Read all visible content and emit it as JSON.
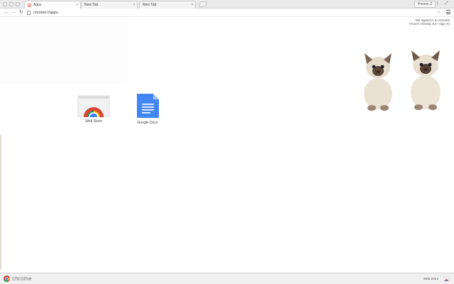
{
  "tabs": [
    {
      "label": "Apps",
      "active": true,
      "icon": "apps-grid-icon"
    },
    {
      "label": "New Tab",
      "active": false
    },
    {
      "label": "New Tab",
      "active": false
    }
  ],
  "profile": {
    "label": "Person 2"
  },
  "toolbar": {
    "url": "chrome://apps"
  },
  "signin": {
    "line1": "Not signed in to Chrome",
    "line2": "(You're missing out—sign in)"
  },
  "apps": [
    {
      "label": "Web Store",
      "icon": "web-store-icon"
    },
    {
      "label": "Google Docs",
      "icon": "google-docs-icon"
    }
  ],
  "shelf": {
    "brand": "chrome",
    "link": "Web Store"
  },
  "colors": {
    "docs_blue": "#4285f4",
    "chrome_red": "#db4437",
    "chrome_green": "#0f9d58",
    "chrome_yellow": "#f4b400"
  }
}
